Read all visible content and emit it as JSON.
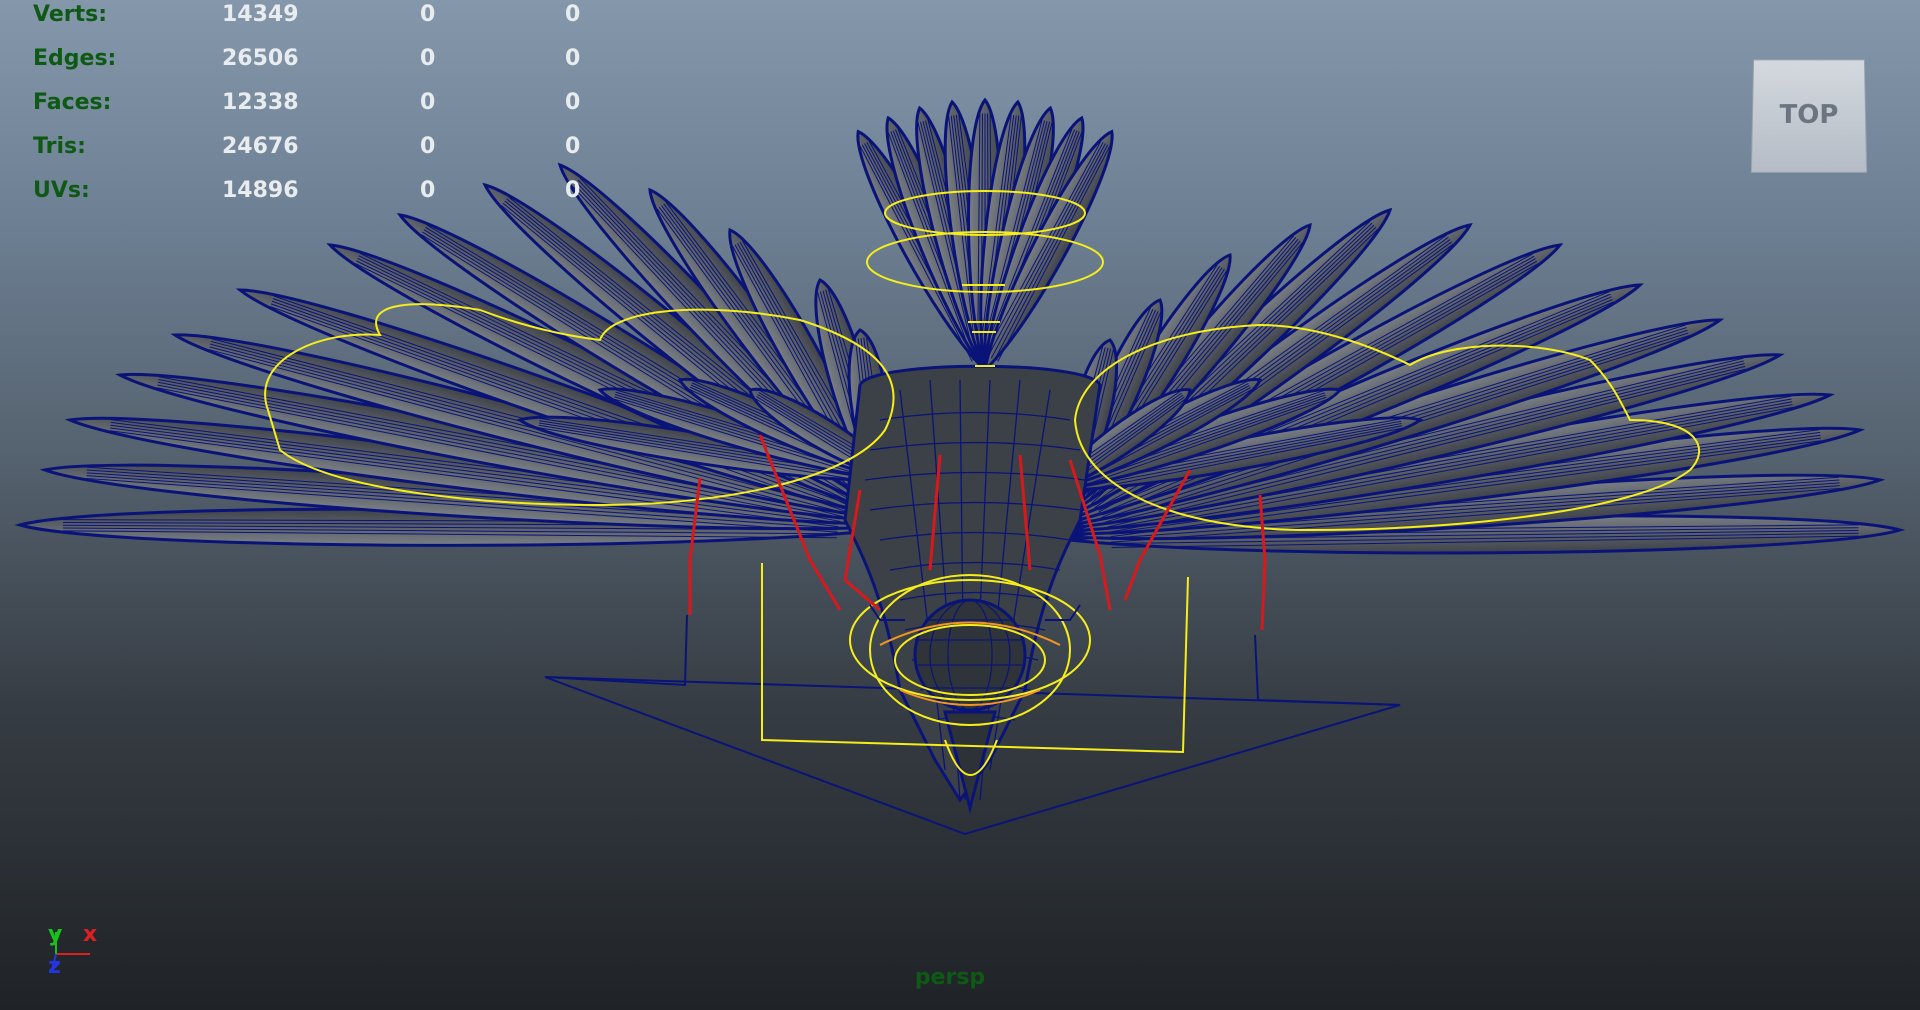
{
  "hud": {
    "rows": [
      {
        "label": "Verts:",
        "v1": "14349",
        "v2": "0",
        "v3": "0"
      },
      {
        "label": "Edges:",
        "v1": "26506",
        "v2": "0",
        "v3": "0"
      },
      {
        "label": "Faces:",
        "v1": "12338",
        "v2": "0",
        "v3": "0"
      },
      {
        "label": "Tris:",
        "v1": "24676",
        "v2": "0",
        "v3": "0"
      },
      {
        "label": "UVs:",
        "v1": "14896",
        "v2": "0",
        "v3": "0"
      }
    ]
  },
  "viewcube": {
    "label": "TOP"
  },
  "camera": {
    "name": "persp"
  },
  "axis": {
    "y": "y",
    "x": "x",
    "z": "z"
  },
  "colors": {
    "wireframe": "#0a1478",
    "feather_fill": "#5d6268",
    "control_yellow": "#f5ee1a",
    "joint_red": "#d8191c",
    "axis_x": "#e02020",
    "axis_y": "#19c21b",
    "axis_z": "#2236e8"
  },
  "icons": [
    "view-cube-icon",
    "axis-gizmo-icon"
  ]
}
